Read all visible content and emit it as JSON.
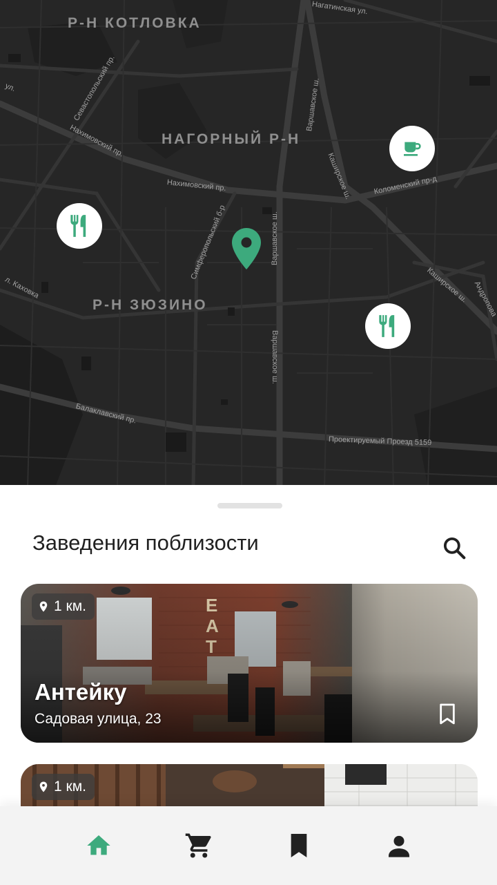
{
  "map": {
    "districts": [
      "Р-Н КОТЛОВКА",
      "НАГОРНЫЙ Р-Н",
      "Р-Н ЗЮЗИНО"
    ],
    "streets": [
      "Нагатинская ул.",
      "Варшавское ш.",
      "Севастопольский пр.",
      "Нахимовский пр.",
      "Нахимовский пр.",
      "Каширское ш.",
      "Коломенский пр-д",
      "Симферопольский б-р",
      "Варшавское ш.",
      "Каширское ш.",
      "Андроповa",
      "л. Каховка",
      "Варшавское ш.",
      "Балаклавский пр.",
      "Проектируемый Проезд 5159",
      "ул."
    ],
    "accent_color": "#3daa7d",
    "markers": [
      {
        "type": "cafe",
        "icon": "coffee-cup-icon"
      },
      {
        "type": "restaurant",
        "icon": "fork-knife-icon"
      },
      {
        "type": "restaurant",
        "icon": "fork-knife-icon"
      }
    ]
  },
  "sheet": {
    "title": "Заведения поблизости",
    "search_icon": "search-icon"
  },
  "places": [
    {
      "distance": "1 км.",
      "name": "Антейку",
      "address": "Садовая улица, 23"
    },
    {
      "distance": "1 км."
    }
  ],
  "nav": {
    "active_color": "#3daa7d",
    "items": [
      "home-icon",
      "cart-icon",
      "bookmark-icon",
      "profile-icon"
    ]
  }
}
